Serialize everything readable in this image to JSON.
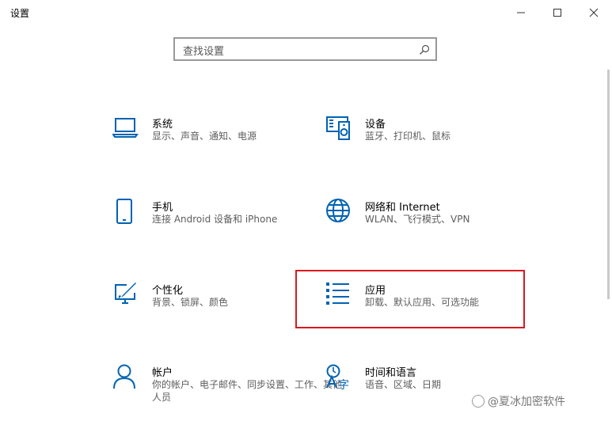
{
  "window": {
    "title": "设置",
    "minimize_icon": "minimize-icon",
    "maximize_icon": "maximize-icon",
    "close_icon": "close-icon"
  },
  "search": {
    "placeholder": "查找设置",
    "icon": "search-icon"
  },
  "categories": [
    {
      "label": "系统",
      "desc": "显示、声音、通知、电源",
      "icon": "laptop-icon"
    },
    {
      "label": "设备",
      "desc": "蓝牙、打印机、鼠标",
      "icon": "devices-icon"
    },
    {
      "label": "手机",
      "desc": "连接 Android 设备和 iPhone",
      "icon": "phone-icon"
    },
    {
      "label": "网络和 Internet",
      "desc": "WLAN、飞行模式、VPN",
      "icon": "globe-icon"
    },
    {
      "label": "个性化",
      "desc": "背景、锁屏、颜色",
      "icon": "personalization-icon"
    },
    {
      "label": "应用",
      "desc": "卸载、默认应用、可选功能",
      "icon": "apps-list-icon"
    },
    {
      "label": "帐户",
      "desc": "你的帐户、电子邮件、同步设置、工作、其他人员",
      "icon": "person-icon"
    },
    {
      "label": "时间和语言",
      "desc": "语音、区域、日期",
      "icon": "time-language-icon"
    }
  ],
  "highlighted_category": "应用",
  "accent_color": "#0063b1",
  "highlight_color": "#d9191f",
  "watermark": "@夏冰加密软件"
}
